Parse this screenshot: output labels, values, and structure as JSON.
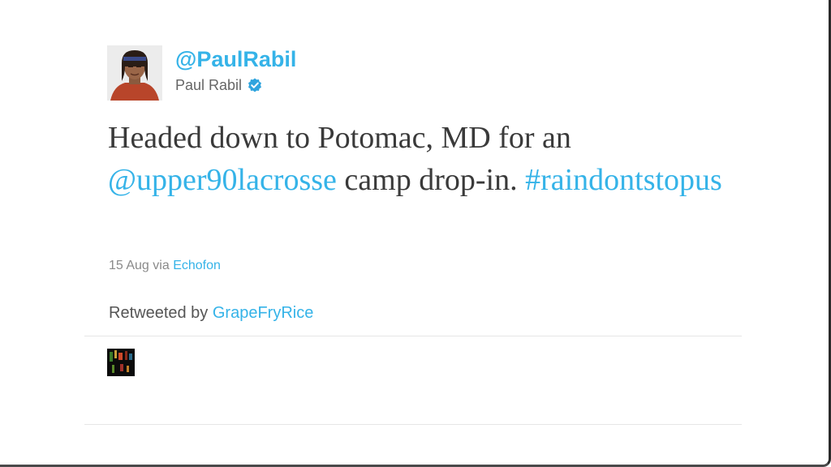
{
  "tweet": {
    "screen_name": "@PaulRabil",
    "full_name": "Paul Rabil",
    "verified_icon": "verified-badge-icon",
    "text": {
      "part1": "Headed down to Potomac, MD for an ",
      "mention": "@upper90lacrosse",
      "part2": " camp drop-in. ",
      "hashtag": "#raindontstopus"
    },
    "date": "15 Aug",
    "via_prefix": "via",
    "source": "Echofon",
    "retweeted_by_label": "Retweeted by",
    "retweeted_by_user": "GrapeFryRice"
  },
  "colors": {
    "link": "#35b3e8",
    "text": "#3a3a3a",
    "meta": "#8a8a8a"
  }
}
